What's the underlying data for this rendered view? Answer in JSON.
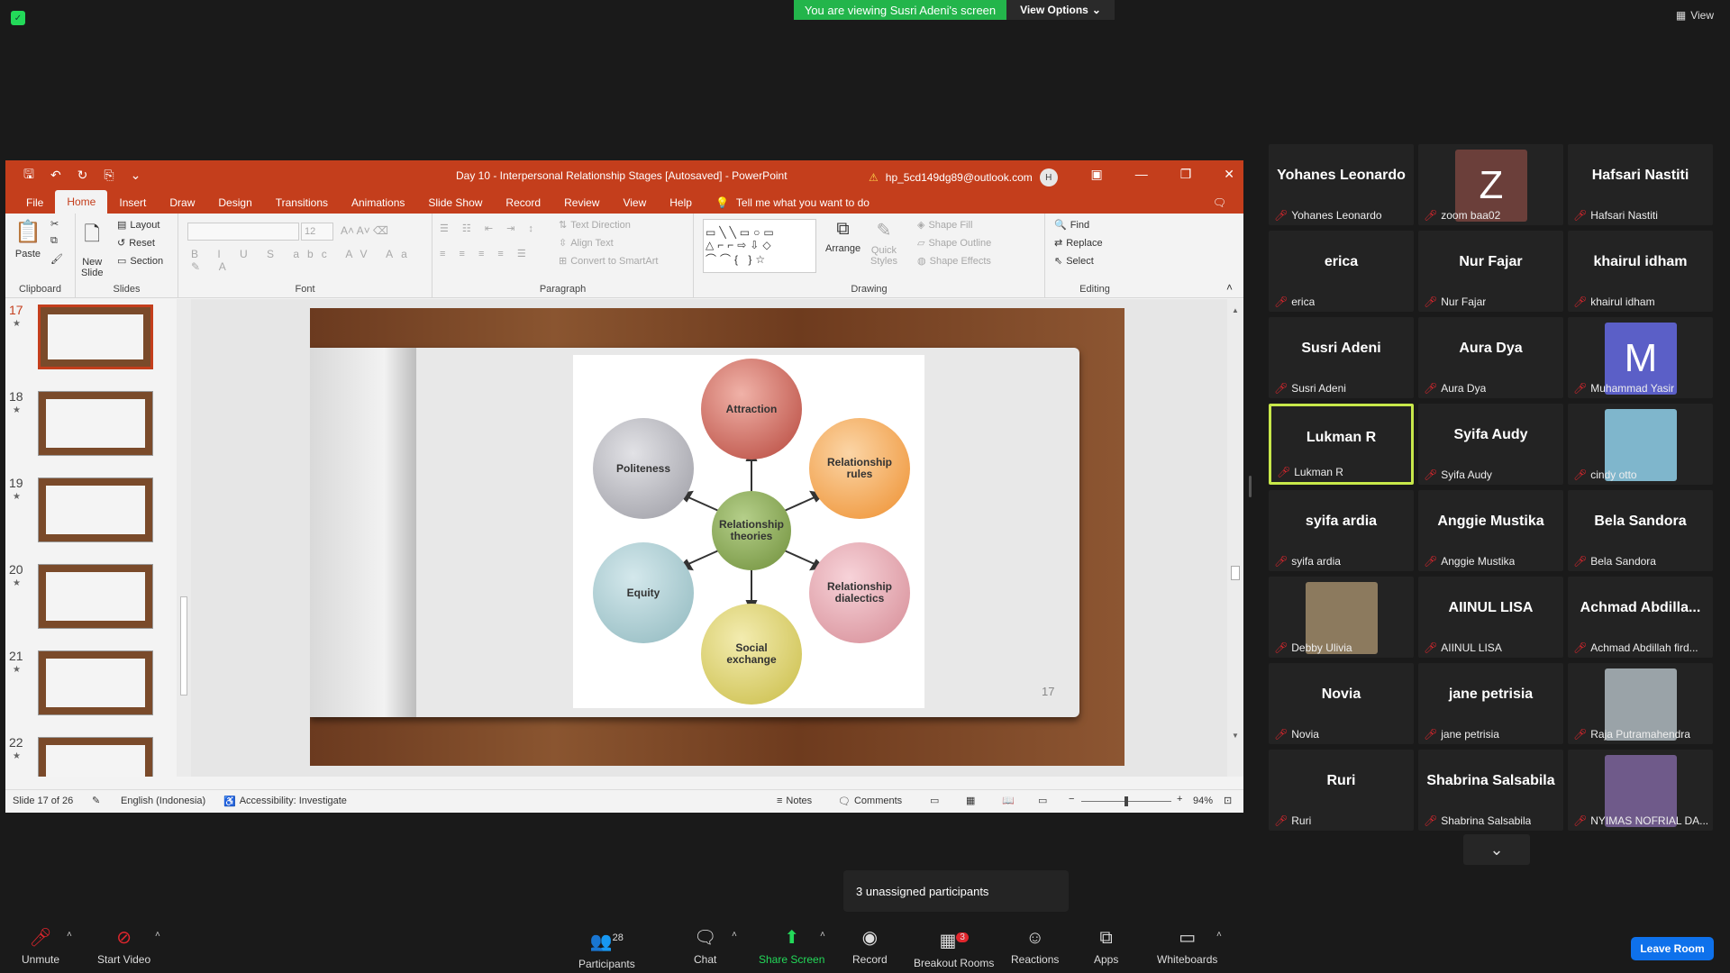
{
  "banner": {
    "viewing": "You are viewing Susri Adeni's screen",
    "view_options": "View Options",
    "view": "View"
  },
  "ppt": {
    "title": "Day 10 - Interpersonal Relationship Stages [Autosaved]  -  PowerPoint",
    "account": "hp_5cd149dg89@outlook.com",
    "avatar": "H",
    "menu": [
      "File",
      "Home",
      "Insert",
      "Draw",
      "Design",
      "Transitions",
      "Animations",
      "Slide Show",
      "Record",
      "Review",
      "View",
      "Help"
    ],
    "tell_me": "Tell me what you want to do",
    "ribbon": {
      "paste": "Paste",
      "new_slide": "New\nSlide",
      "layout": "Layout",
      "reset": "Reset",
      "section": "Section",
      "font_size": "12",
      "text_direction": "Text Direction",
      "align_text": "Align Text",
      "convert_smartart": "Convert to SmartArt",
      "arrange": "Arrange",
      "quick_styles": "Quick\nStyles",
      "shape_fill": "Shape Fill",
      "shape_outline": "Shape Outline",
      "shape_effects": "Shape Effects",
      "find": "Find",
      "replace": "Replace",
      "select": "Select",
      "groups": [
        "Clipboard",
        "Slides",
        "Font",
        "Paragraph",
        "Drawing",
        "Editing"
      ]
    },
    "thumbs": [
      "17",
      "18",
      "19",
      "20",
      "21",
      "22"
    ],
    "slide": {
      "center": "Relationship\ntheories",
      "circles": [
        "Attraction",
        "Relationship\nrules",
        "Relationship\ndialectics",
        "Social\nexchange",
        "Equity",
        "Politeness"
      ],
      "number": "17"
    },
    "status": {
      "slide_count": "Slide 17 of 26",
      "language": "English (Indonesia)",
      "accessibility": "Accessibility: Investigate",
      "notes": "Notes",
      "comments": "Comments",
      "zoom": "94%"
    }
  },
  "participants": [
    {
      "name": "Yohanes Leonardo",
      "label": "Yohanes Leonardo"
    },
    {
      "name": "Z",
      "label": "zoom baa02",
      "avatar_color": "#6b3f3a"
    },
    {
      "name": "Hafsari Nastiti",
      "label": "Hafsari Nastiti"
    },
    {
      "name": "erica",
      "label": "erica"
    },
    {
      "name": "Nur Fajar",
      "label": "Nur Fajar"
    },
    {
      "name": "khairul idham",
      "label": "khairul idham"
    },
    {
      "name": "Susri Adeni",
      "label": "Susri Adeni"
    },
    {
      "name": "Aura Dya",
      "label": "Aura Dya"
    },
    {
      "name": "M",
      "label": "Muhammad Yasir",
      "avatar_color": "#5b5fc7"
    },
    {
      "name": "Lukman R",
      "label": "Lukman R"
    },
    {
      "name": "Syifa Audy",
      "label": "Syifa Audy"
    },
    {
      "name": "",
      "label": "cindy otto",
      "avatar_color": "#7fb6cc"
    },
    {
      "name": "syifa ardia",
      "label": "syifa ardia"
    },
    {
      "name": "Anggie Mustika",
      "label": "Anggie Mustika"
    },
    {
      "name": "Bela Sandora",
      "label": "Bela Sandora"
    },
    {
      "name": "",
      "label": "Debby Ulivia",
      "avatar_color": "#8c7a5e"
    },
    {
      "name": "AIINUL LISA",
      "label": "AIINUL LISA"
    },
    {
      "name": "Achmad  Abdilla...",
      "label": "Achmad Abdillah fird..."
    },
    {
      "name": "Novia",
      "label": "Novia"
    },
    {
      "name": "jane petrisia",
      "label": "jane petrisia"
    },
    {
      "name": "",
      "label": "Raja Putramahendra",
      "avatar_color": "#9aa3a8"
    },
    {
      "name": "Ruri",
      "label": "Ruri"
    },
    {
      "name": "Shabrina Salsabila",
      "label": "Shabrina Salsabila"
    },
    {
      "name": "",
      "label": "NYIMAS NOFRIAL DA...",
      "avatar_color": "#6f5a8a"
    }
  ],
  "toast": "3 unassigned participants",
  "toolbar": {
    "unmute": "Unmute",
    "start_video": "Start Video",
    "participants": "Participants",
    "participants_count": "28",
    "chat": "Chat",
    "share_screen": "Share Screen",
    "record": "Record",
    "breakout": "Breakout Rooms",
    "breakout_badge": "3",
    "reactions": "Reactions",
    "apps": "Apps",
    "whiteboards": "Whiteboards",
    "leave": "Leave Room"
  }
}
